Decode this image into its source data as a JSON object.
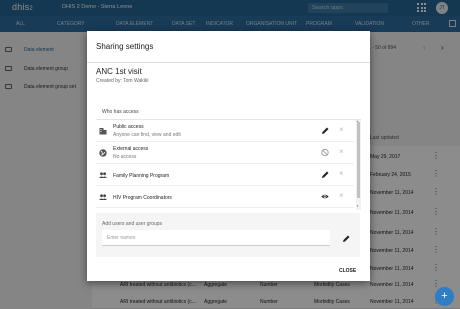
{
  "header": {
    "logo": "dhis",
    "logo_sup": "2",
    "title": "DHIS 2 Demo - Sierra Leone",
    "search_placeholder": "Search apps",
    "user_initials": "JT"
  },
  "tabs": [
    "ALL",
    "CATEGORY",
    "DATA ELEMENT",
    "DATA SET",
    "INDICATOR",
    "ORGANISATION UNIT",
    "PROGRAM",
    "VALIDATION",
    "OTHER"
  ],
  "sidebar": {
    "items": [
      {
        "label": "Data element",
        "active": true
      },
      {
        "label": "Data element group",
        "active": false
      },
      {
        "label": "Data element group set",
        "active": false
      }
    ]
  },
  "list": {
    "pager_text": "1 - 50 of 894",
    "column_last_updated": "Last updated",
    "rows": [
      {
        "name": "",
        "domain": "",
        "value_type": "",
        "category": "",
        "date": "May 29, 2017"
      },
      {
        "name": "",
        "domain": "",
        "value_type": "",
        "category": "",
        "date": "February 24, 2015"
      },
      {
        "name": "",
        "domain": "",
        "value_type": "",
        "category": "",
        "date": "November 11, 2014"
      },
      {
        "name": "",
        "domain": "",
        "value_type": "",
        "category": "",
        "date": "November 11, 2014"
      },
      {
        "name": "",
        "domain": "",
        "value_type": "",
        "category": "",
        "date": "November 11, 2014"
      },
      {
        "name": "",
        "domain": "",
        "value_type": "",
        "category": "",
        "date": "November 11, 2014"
      },
      {
        "name": "",
        "domain": "",
        "value_type": "",
        "category": "",
        "date": "November 11, 2014"
      },
      {
        "name": "ARI treated without antibiotics (c...",
        "domain": "Aggregate",
        "value_type": "Number",
        "category": "Morbidity Cases",
        "date": "November 11, 2014"
      },
      {
        "name": "ARI treated without antibiotics (c...",
        "domain": "Aggregate",
        "value_type": "Number",
        "category": "Morbidity Cases",
        "date": "November 11, 2014"
      }
    ]
  },
  "dialog": {
    "title": "Sharing settings",
    "object_name": "ANC 1st visit",
    "created_by": "Created by: Tom Wakiki",
    "who_has_access": "Who has access",
    "access": [
      {
        "name": "Public access",
        "detail": "Anyone can find, view and edit",
        "icon": "business-icon",
        "action": "pencil-icon"
      },
      {
        "name": "External access",
        "detail": "No access",
        "icon": "public-globe-icon",
        "action": "block-icon"
      },
      {
        "name": "Family Planning Program",
        "detail": "",
        "icon": "group-icon",
        "action": "pencil-icon"
      },
      {
        "name": "HIV Program Coordinators",
        "detail": "",
        "icon": "group-icon",
        "action": "eye-icon"
      }
    ],
    "add_label": "Add users and user groups",
    "add_placeholder": "Enter names",
    "close_label": "CLOSE"
  },
  "colors": {
    "header": "#276696",
    "tabbar": "#2c6ca0",
    "fab": "#2f7dc4"
  }
}
